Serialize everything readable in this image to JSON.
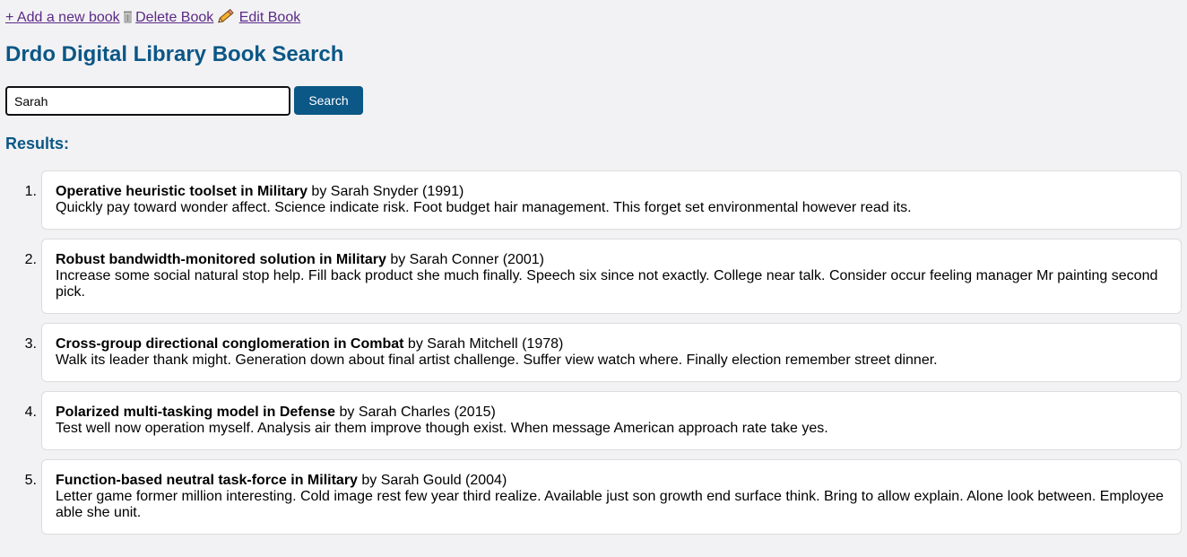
{
  "toolbar": {
    "add_label": "+ Add a new book",
    "delete_label": "Delete Book",
    "edit_label": "Edit Book"
  },
  "page": {
    "title": "Drdo Digital Library Book Search"
  },
  "search": {
    "value": "Sarah",
    "button_label": "Search"
  },
  "results": {
    "heading": "Results:",
    "items": [
      {
        "num": "1.",
        "title": "Operative heuristic toolset in Military",
        "byline": "by Sarah Snyder (1991)",
        "description": "Quickly pay toward wonder affect. Science indicate risk. Foot budget hair management. This forget set environmental however read its."
      },
      {
        "num": "2.",
        "title": "Robust bandwidth-monitored solution in Military",
        "byline": "by Sarah Conner (2001)",
        "description": "Increase some social natural stop help. Fill back product she much finally. Speech six since not exactly. College near talk. Consider occur feeling manager Mr painting second pick."
      },
      {
        "num": "3.",
        "title": "Cross-group directional conglomeration in Combat",
        "byline": "by Sarah Mitchell (1978)",
        "description": "Walk its leader thank might. Generation down about final artist challenge. Suffer view watch where. Finally election remember street dinner."
      },
      {
        "num": "4.",
        "title": "Polarized multi-tasking model in Defense",
        "byline": "by Sarah Charles (2015)",
        "description": "Test well now operation myself. Analysis air them improve though exist. When message American approach rate take yes."
      },
      {
        "num": "5.",
        "title": "Function-based neutral task-force in Military",
        "byline": "by Sarah Gould (2004)",
        "description": "Letter game former million interesting. Cold image rest few year third realize. Available just son growth end surface think. Bring to allow explain. Alone look between. Employee able she unit."
      }
    ]
  },
  "icons": {
    "delete": "wastebasket-icon",
    "edit": "pencil-icon"
  },
  "colors": {
    "accent": "#0b5786",
    "link": "#5b2a86",
    "background": "#f2f2f4"
  }
}
